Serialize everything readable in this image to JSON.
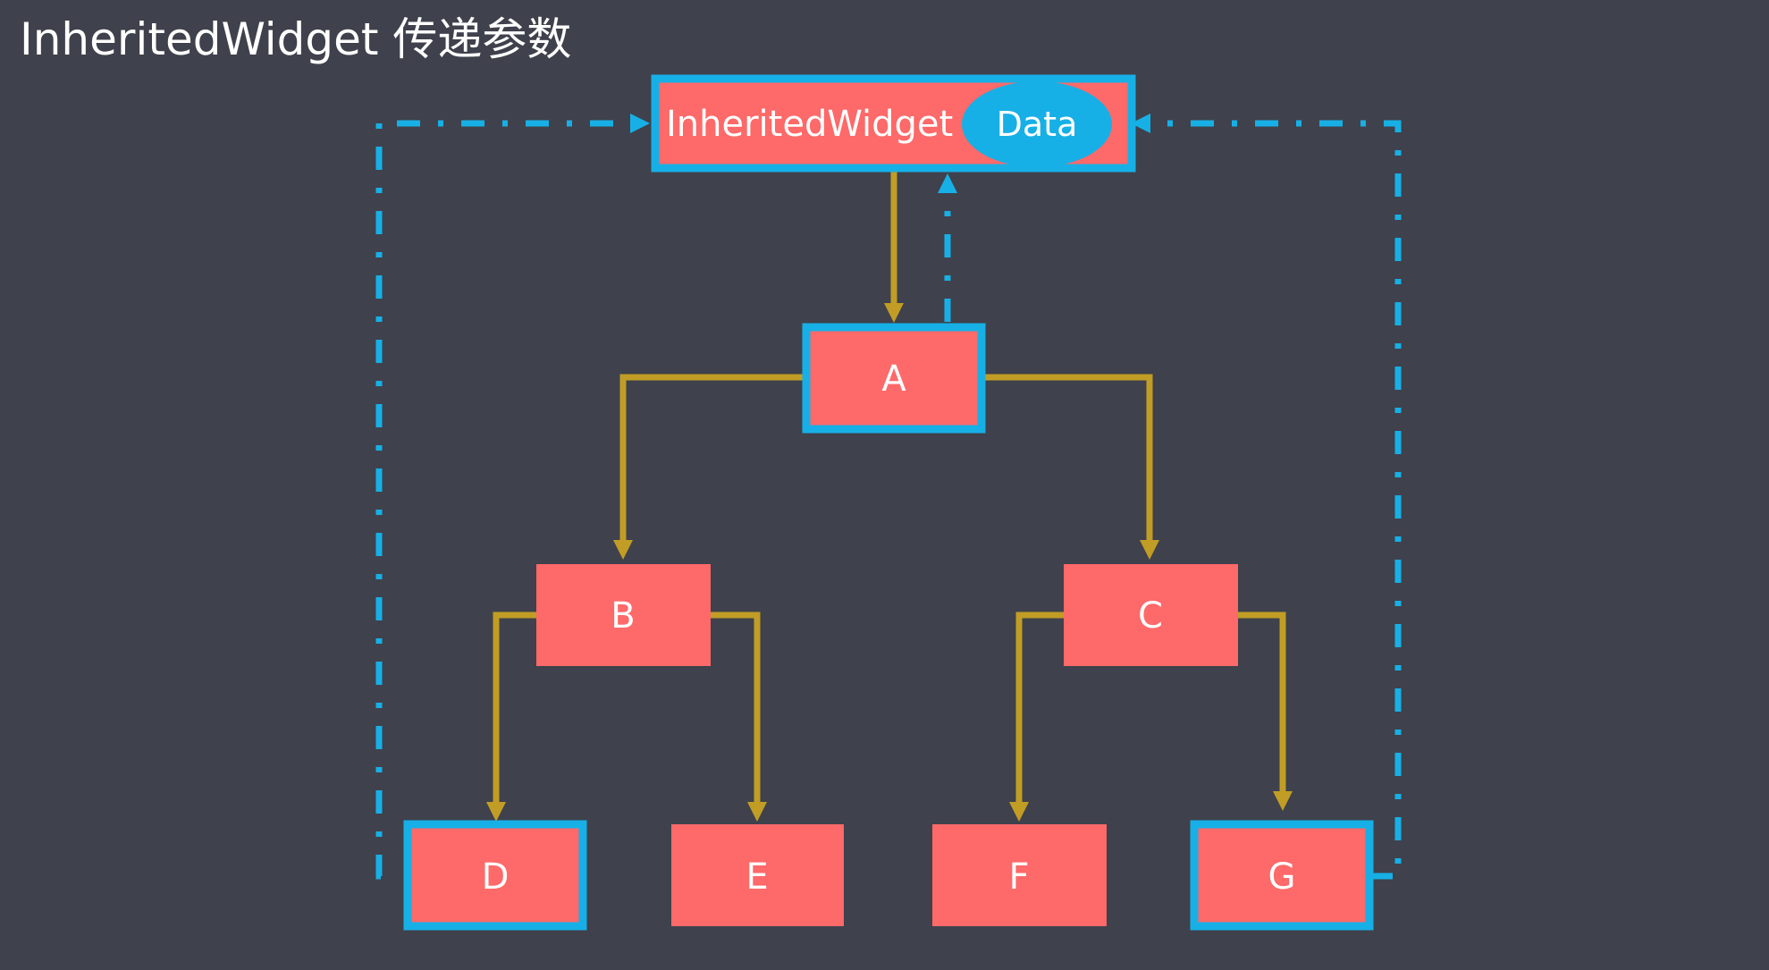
{
  "title": "InheritedWidget 传递参数",
  "colors": {
    "background": "#3f414c",
    "node_fill": "#fe6969",
    "highlight_border": "#17b0e6",
    "tree_edge": "#c19d25",
    "data_ellipse": "#17b0e6",
    "text": "#ffffff"
  },
  "root": {
    "label": "InheritedWidget",
    "data_label": "Data"
  },
  "nodes": {
    "a": "A",
    "b": "B",
    "c": "C",
    "d": "D",
    "e": "E",
    "f": "F",
    "g": "G"
  }
}
